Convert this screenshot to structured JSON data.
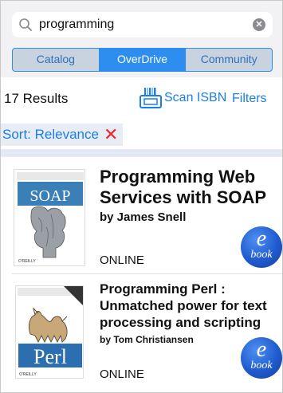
{
  "search": {
    "query": "programming"
  },
  "tabs": [
    {
      "label": "Catalog",
      "active": false
    },
    {
      "label": "OverDrive",
      "active": true
    },
    {
      "label": "Community",
      "active": false
    }
  ],
  "results": {
    "count_label": "17 Results"
  },
  "actions": {
    "scan_label": "Scan ISBN",
    "filters_label": "Filters"
  },
  "sort": {
    "label": "Sort: Relevance"
  },
  "books": [
    {
      "title": "Programming Web Services with SOAP",
      "author": "by James Snell",
      "status": "ONLINE",
      "format_badge": {
        "e": "e",
        "word": "book"
      },
      "cover": {
        "publisher": "O'REILLY",
        "big_word": "SOAP",
        "color": "#3a7fb5"
      }
    },
    {
      "title": "Programming Perl : Unmatched power for text processing and scripting",
      "author": "by Tom Christiansen",
      "status": "ONLINE",
      "format_badge": {
        "e": "e",
        "word": "book"
      },
      "cover": {
        "publisher": "O'REILLY",
        "big_word": "Perl",
        "color": "#2c6fb0"
      }
    }
  ],
  "colors": {
    "accent": "#1a7ee8",
    "segment_active": "#2e8ef0",
    "sort_x": "#e8262d",
    "badge": "#1f5bd0"
  }
}
